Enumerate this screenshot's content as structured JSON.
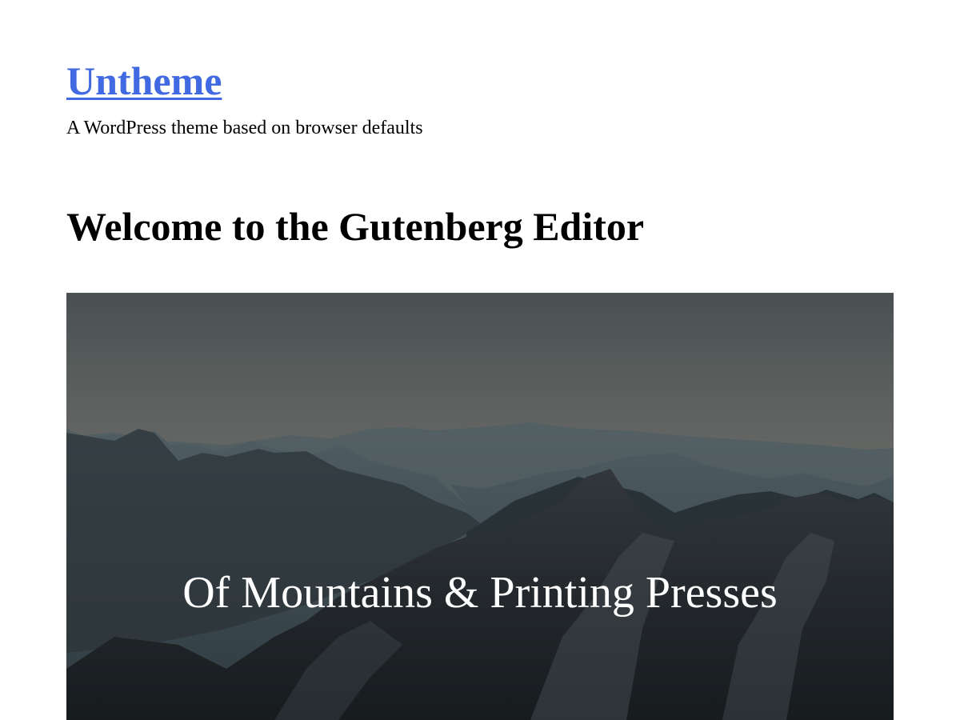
{
  "header": {
    "site_title": "Untheme",
    "site_description": "A WordPress theme based on browser defaults"
  },
  "post": {
    "title": "Welcome to the Gutenberg Editor",
    "cover": {
      "text": "Of Mountains & Printing Presses",
      "image_subject": "mountain range at dusk"
    }
  },
  "colors": {
    "link": "#4169e1",
    "text": "#000000",
    "cover_text": "#ffffff"
  }
}
